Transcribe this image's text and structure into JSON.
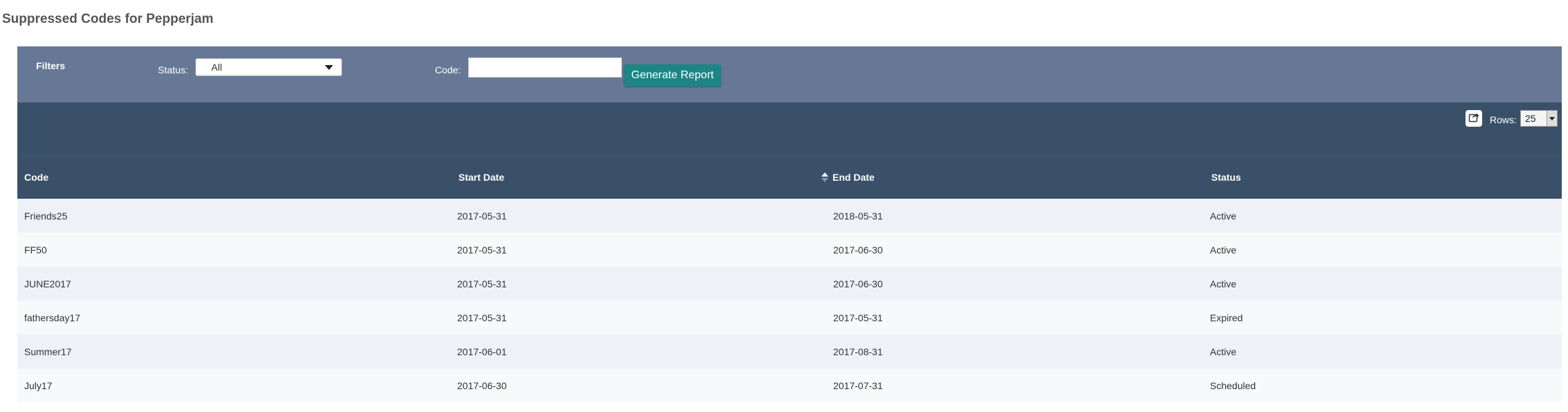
{
  "page": {
    "title": "Suppressed Codes for Pepperjam"
  },
  "filters": {
    "title": "Filters",
    "status_label": "Status:",
    "status_value": "All",
    "code_label": "Code:",
    "code_value": "",
    "generate_label": "Generate Report"
  },
  "toolbar": {
    "export_icon": "share-export-icon",
    "rows_label": "Rows:",
    "rows_value": "25"
  },
  "table": {
    "columns": {
      "code": "Code",
      "start_date": "Start Date",
      "end_date": "End Date",
      "status": "Status"
    },
    "sorted_column": "end_date",
    "rows": [
      {
        "code": "Friends25",
        "start_date": "2017-05-31",
        "end_date": "2018-05-31",
        "status": "Active"
      },
      {
        "code": "FF50",
        "start_date": "2017-05-31",
        "end_date": "2017-06-30",
        "status": "Active"
      },
      {
        "code": "JUNE2017",
        "start_date": "2017-05-31",
        "end_date": "2017-06-30",
        "status": "Active"
      },
      {
        "code": "fathersday17",
        "start_date": "2017-05-31",
        "end_date": "2017-05-31",
        "status": "Expired"
      },
      {
        "code": "Summer17",
        "start_date": "2017-06-01",
        "end_date": "2017-08-31",
        "status": "Active"
      },
      {
        "code": "July17",
        "start_date": "2017-06-30",
        "end_date": "2017-07-31",
        "status": "Scheduled"
      }
    ]
  },
  "colors": {
    "filters_bar": "#667895",
    "header_bar": "#3a5068",
    "button": "#1d8585"
  }
}
